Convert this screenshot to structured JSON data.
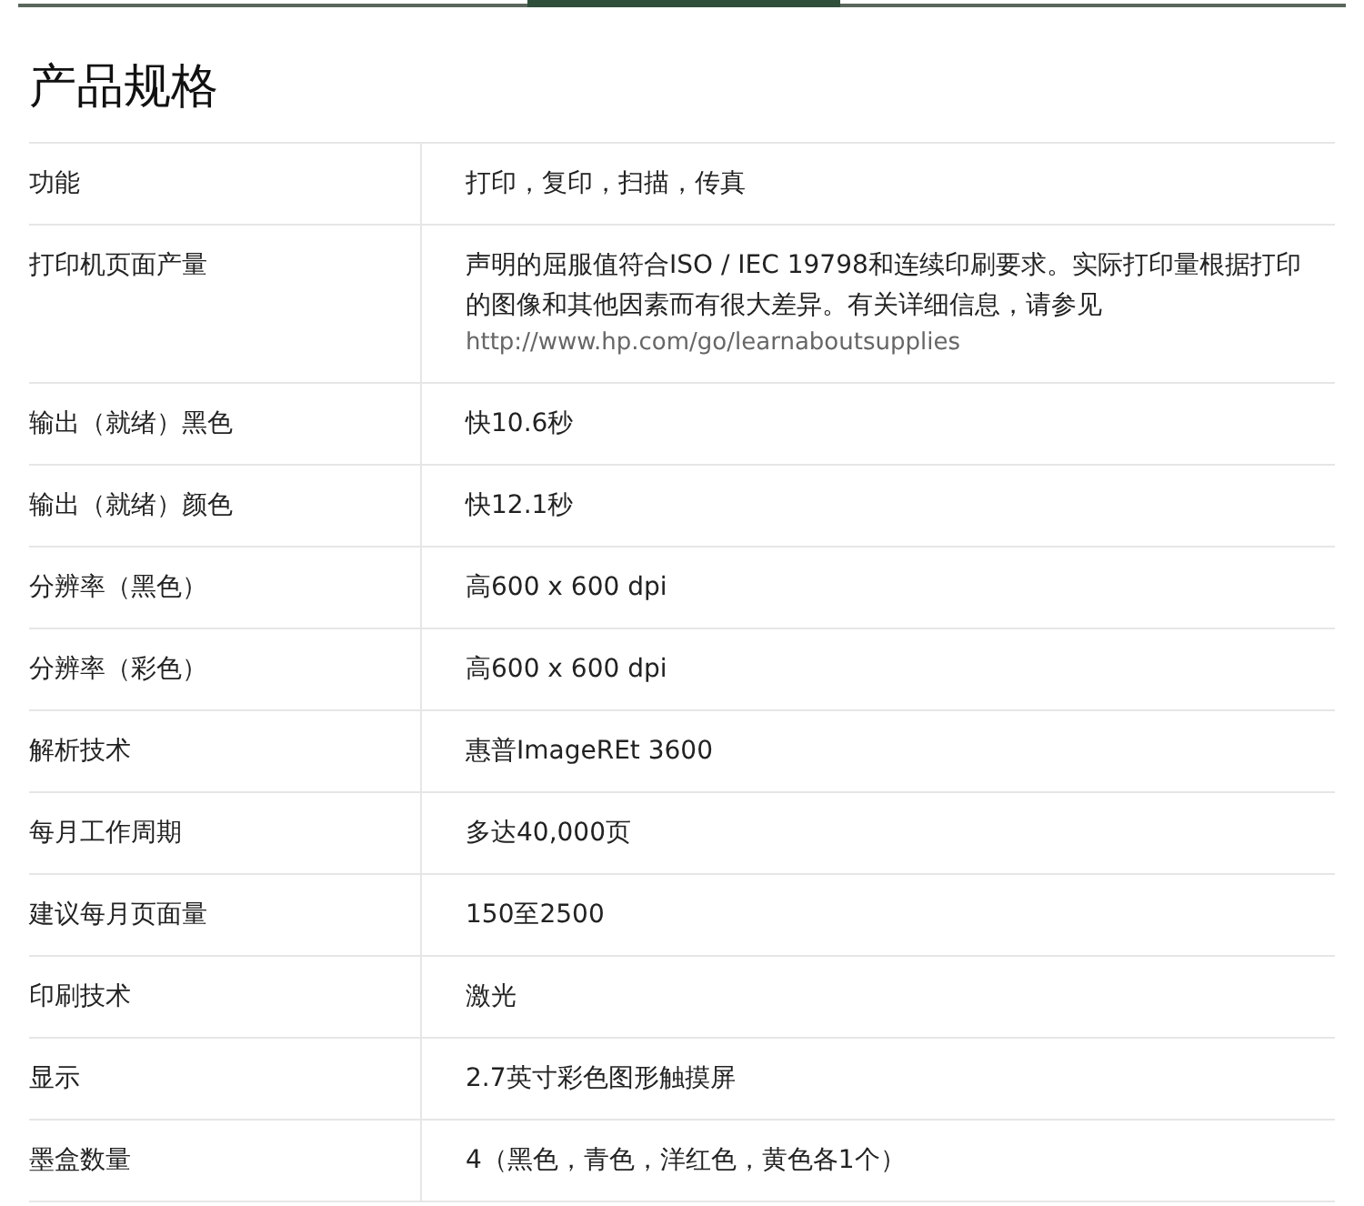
{
  "title": "产品规格",
  "rows": [
    {
      "label": "功能",
      "value": "打印，复印，扫描，传真"
    },
    {
      "label": "打印机页面产量",
      "value": "声明的屈服值符合ISO / IEC 19798和连续印刷要求。实际打印量根据打印的图像和其他因素而有很大差异。有关详细信息，请参见",
      "link": "http://www.hp.com/go/learnaboutsupplies"
    },
    {
      "label": "输出（就绪）黑色",
      "value": "快10.6秒"
    },
    {
      "label": "输出（就绪）颜色",
      "value": "快12.1秒"
    },
    {
      "label": "分辨率（黑色）",
      "value": "高600 x 600 dpi"
    },
    {
      "label": "分辨率（彩色）",
      "value": "高600 x 600 dpi"
    },
    {
      "label": "解析技术",
      "value": "惠普ImageREt 3600"
    },
    {
      "label": "每月工作周期",
      "value": "多达40,000页"
    },
    {
      "label": "建议每月页面量",
      "value": "150至2500"
    },
    {
      "label": "印刷技术",
      "value": "激光"
    },
    {
      "label": "显示",
      "value": "2.7英寸彩色图形触摸屏"
    },
    {
      "label": "墨盒数量",
      "value": "4（黑色，青色，洋红色，黄色各1个）"
    }
  ]
}
